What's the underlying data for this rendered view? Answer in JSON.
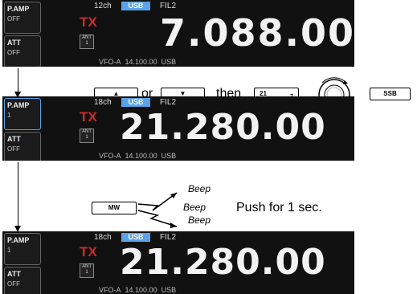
{
  "panels": [
    {
      "preamp_label": "P.AMP",
      "preamp_value": "OFF",
      "att_label": "ATT",
      "att_value": "OFF",
      "channels": "12ch",
      "mode": "USB",
      "filter": "FIL2",
      "tx": "TX",
      "ant_label": "ANT",
      "ant_num": "1",
      "frequency": "7.088.00",
      "vfo": "VFO-A",
      "vfo_freq": "14.100.00",
      "vfo_mode": "USB"
    },
    {
      "preamp_label": "P.AMP",
      "preamp_value": "1",
      "att_label": "ATT",
      "att_value": "OFF",
      "channels": "18ch",
      "mode": "USB",
      "filter": "FIL2",
      "tx": "TX",
      "ant_label": "ANT",
      "ant_num": "1",
      "frequency": "21.280.00",
      "vfo": "VFO-A",
      "vfo_freq": "14.100.00",
      "vfo_mode": "USB"
    },
    {
      "preamp_label": "P.AMP",
      "preamp_value": "1",
      "att_label": "ATT",
      "att_value": "OFF",
      "channels": "18ch",
      "mode": "USB",
      "filter": "FIL2",
      "tx": "TX",
      "ant_label": "ANT",
      "ant_num": "1",
      "frequency": "21.280.00",
      "vfo": "VFO-A",
      "vfo_freq": "14.100.00",
      "vfo_mode": "USB"
    }
  ],
  "step1": {
    "up_key": "▲",
    "or_text": "or",
    "down_key": "▼",
    "then_text": "then",
    "band_key_main": "21",
    "band_key_sub": "7",
    "ssb_key": "SSB"
  },
  "step2": {
    "mw_key": "MW",
    "beep1": "Beep",
    "beep2": "Beep",
    "beep3": "Beep",
    "push_text": "Push for 1 sec."
  }
}
